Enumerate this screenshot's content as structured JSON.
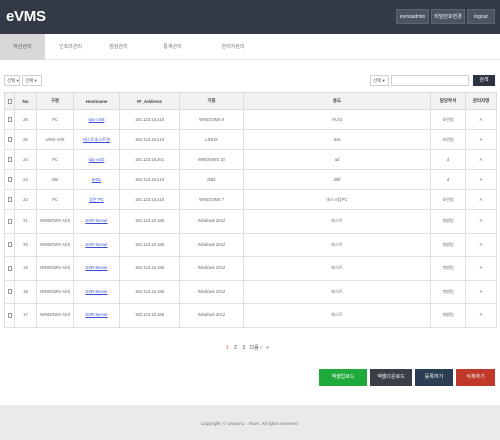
{
  "app": {
    "logo": "eVMS"
  },
  "header": {
    "user_label": "evmsadmin",
    "password_label": "비밀번호변경",
    "logout_label": "logout"
  },
  "tabs": [
    {
      "label": "자산관리",
      "active": true
    },
    {
      "label": "인프라관리",
      "active": false
    },
    {
      "label": "점검관리",
      "active": false
    },
    {
      "label": "통계관리",
      "active": false
    },
    {
      "label": "관리자관리",
      "active": false
    }
  ],
  "filters": {
    "filter1": "선택 ▾",
    "filter2": "선택 ▾",
    "search_select": "선택 ▾",
    "search_value": "",
    "search_button": "검색"
  },
  "table": {
    "headers": [
      "",
      "No",
      "구분",
      "Hostname",
      "IP_Address",
      "기종",
      "용도",
      "담당부서",
      "관리자명"
    ],
    "rows": [
      {
        "no": "26",
        "type": "PC",
        "host": "spc-cm6",
        "ip": "192.123.16.210",
        "os": "WINDOWS 8",
        "usage": "가나다",
        "dept": "보안팀",
        "admin": "A"
      },
      {
        "no": "25",
        "type": "UNIX-서버",
        "host": "테스트호스트명",
        "ip": "192.123.16.210",
        "os": "LINUX",
        "usage": "test",
        "dept": "보안팀",
        "admin": "A"
      },
      {
        "no": "24",
        "type": "PC",
        "host": "spc-w10",
        "ip": "192.123.16.201",
        "os": "WINDOWS 10",
        "usage": "ad",
        "dept": "d",
        "admin": "A"
      },
      {
        "no": "23",
        "type": "DB",
        "host": "test1",
        "ip": "192.123.16.210",
        "os": "DB2",
        "usage": "dfdf",
        "dept": "d",
        "admin": "A"
      },
      {
        "no": "22",
        "type": "PC",
        "host": "잡은 PC",
        "ip": "192.123.16.210",
        "os": "WINDOWS 7",
        "usage": "데스크탑PC",
        "dept": "보안팀",
        "admin": "A"
      },
      {
        "no": "21",
        "type": "WINDOWS-서버",
        "host": "SVR-Server",
        "ip": "192.123.16.186",
        "os": "Windows 2012",
        "usage": "테스트",
        "dept": "개발팀",
        "admin": "A"
      },
      {
        "no": "20",
        "type": "WINDOWS-서버",
        "host": "SVR-Server",
        "ip": "192.123.16.186",
        "os": "Windows 2012",
        "usage": "테스트",
        "dept": "개발팀",
        "admin": "A"
      },
      {
        "no": "19",
        "type": "WINDOWS-서버",
        "host": "SVR-Server",
        "ip": "192.123.16.186",
        "os": "Windows 2012",
        "usage": "테스트",
        "dept": "개발팀",
        "admin": "A"
      },
      {
        "no": "18",
        "type": "WINDOWS-서버",
        "host": "SVR-Server",
        "ip": "192.123.16.186",
        "os": "Windows 2012",
        "usage": "테스트",
        "dept": "개발팀",
        "admin": "A"
      },
      {
        "no": "17",
        "type": "WINDOWS-서버",
        "host": "SVR-Server",
        "ip": "192.123.16.186",
        "os": "Windows 2012",
        "usage": "테스트",
        "dept": "개발팀",
        "admin": "A"
      }
    ]
  },
  "pagination": {
    "pages": [
      "1",
      "2",
      "3"
    ],
    "current": "1",
    "next_label": "다음 ›",
    "last_label": "»"
  },
  "actions": {
    "excel_upload": "엑셀업로드",
    "excel_download": "엑셀다운로드",
    "register": "등록하기",
    "delete": "삭제하기"
  },
  "footer": {
    "copyright": "Copyright ⓒ Umoon1 : Team. All rights reserved."
  },
  "colors": {
    "header_bg": "#323a45",
    "tab_active_bg": "#d8d8d8",
    "search_btn": "#2b3440",
    "excel_upload": "#1faa3c",
    "excel_download": "#3a3f47",
    "register": "#2a3d52",
    "delete": "#c0392b",
    "link": "#3b4fd6",
    "footer_bg": "#eaeaea"
  }
}
